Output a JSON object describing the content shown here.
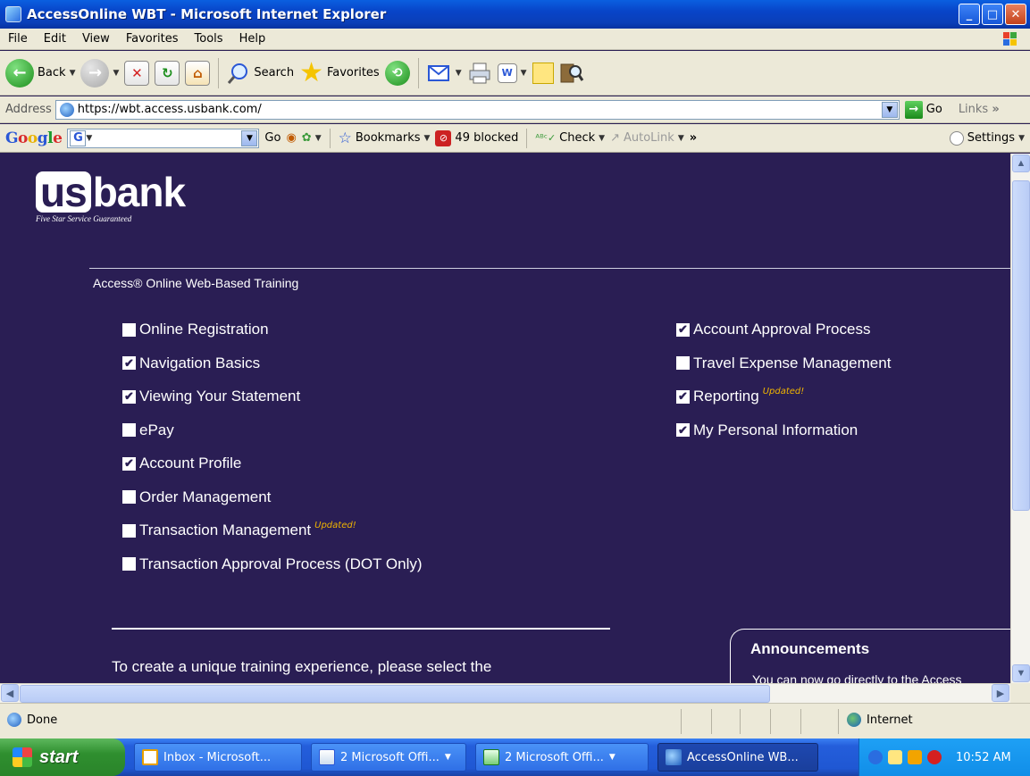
{
  "window": {
    "title": "AccessOnline WBT - Microsoft Internet Explorer",
    "controls": [
      "_",
      "□",
      "✕"
    ]
  },
  "menu": [
    "File",
    "Edit",
    "View",
    "Favorites",
    "Tools",
    "Help"
  ],
  "toolbar": {
    "back_label": "Back",
    "search_label": "Search",
    "favorites_label": "Favorites"
  },
  "address": {
    "label": "Address",
    "url": "https://wbt.access.usbank.com/",
    "go_label": "Go",
    "links_label": "Links"
  },
  "googlebar": {
    "go_label": "Go",
    "bookmarks_label": "Bookmarks",
    "blocked_label": "49 blocked",
    "check_label": "Check",
    "autolink_label": "AutoLink",
    "settings_label": "Settings"
  },
  "page": {
    "logo_us": "us",
    "logo_bank": "bank",
    "logo_tagline": "Five Star Service Guaranteed",
    "subtitle": "Access® Online Web-Based Training",
    "updated_badge": "Updated!",
    "modules_left": [
      {
        "label": "Online Registration",
        "checked": false,
        "updated": false
      },
      {
        "label": "Navigation Basics",
        "checked": true,
        "updated": false
      },
      {
        "label": "Viewing Your Statement",
        "checked": true,
        "updated": false
      },
      {
        "label": "ePay",
        "checked": false,
        "updated": false
      },
      {
        "label": "Account Profile",
        "checked": true,
        "updated": false
      },
      {
        "label": "Order Management",
        "checked": false,
        "updated": false
      },
      {
        "label": "Transaction Management",
        "checked": false,
        "updated": true
      },
      {
        "label": "Transaction Approval Process (DOT Only)",
        "checked": false,
        "updated": false
      }
    ],
    "modules_right": [
      {
        "label": "Account Approval Process",
        "checked": true,
        "updated": false
      },
      {
        "label": "Travel Expense Management",
        "checked": false,
        "updated": false
      },
      {
        "label": "Reporting",
        "checked": true,
        "updated": true
      },
      {
        "label": "My Personal Information",
        "checked": true,
        "updated": false
      }
    ],
    "intro_text": "To create a unique training experience, please select the",
    "announcements_title": "Announcements",
    "announcements_text": "You can now go directly to the Access"
  },
  "status": {
    "text": "Done",
    "zone": "Internet"
  },
  "taskbar": {
    "start_label": "start",
    "tasks": [
      {
        "label": "Inbox - Microsoft...",
        "icon": "outlook-icon"
      },
      {
        "label": "2 Microsoft Offi...",
        "icon": "word-icon"
      },
      {
        "label": "2 Microsoft Offi...",
        "icon": "excel-icon"
      },
      {
        "label": "AccessOnline WB...",
        "icon": "ie-icon"
      }
    ],
    "clock": "10:52 AM"
  },
  "colors": {
    "page_background": "#2a1e54",
    "updated_badge": "#f0b400"
  }
}
